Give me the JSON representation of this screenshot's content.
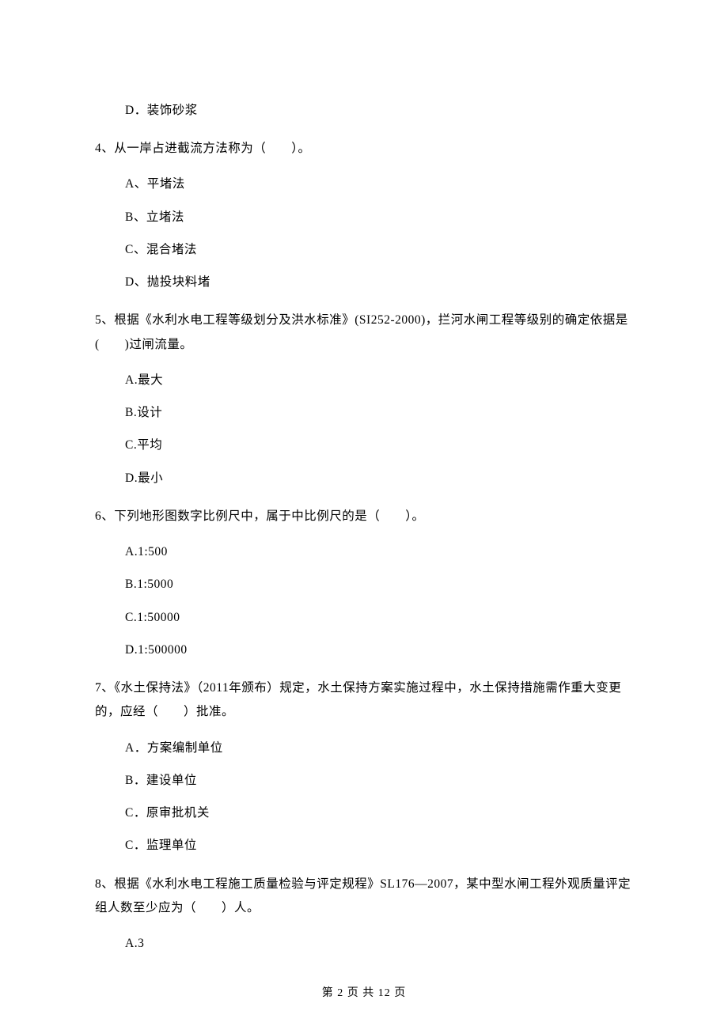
{
  "prev_question_trailing_option": {
    "label": "D．装饰砂浆"
  },
  "questions": [
    {
      "number": "4、",
      "stem": "从一岸占进截流方法称为（　　）。",
      "options": [
        "A、平堵法",
        "B、立堵法",
        "C、混合堵法",
        "D、抛投块料堵"
      ]
    },
    {
      "number": "5、",
      "stem": "根据《水利水电工程等级划分及洪水标准》(SI252-2000)，拦河水闸工程等级别的确定依据是(　　)过闸流量。",
      "options": [
        "A.最大",
        "B.设计",
        "C.平均",
        "D.最小"
      ]
    },
    {
      "number": "6、",
      "stem": "下列地形图数字比例尺中，属于中比例尺的是（　　）。",
      "options": [
        "A.1:500",
        "B.1:5000",
        "C.1:50000",
        "D.1:500000"
      ]
    },
    {
      "number": "7、",
      "stem": "《水土保持法》（2011年颁布）规定，水土保持方案实施过程中，水土保持措施需作重大变更的，应经（　　）批准。",
      "options": [
        "A．方案编制单位",
        "B．建设单位",
        "C．原审批机关",
        "C．监理单位"
      ]
    },
    {
      "number": "8、",
      "stem": "根据《水利水电工程施工质量检验与评定规程》SL176—2007，某中型水闸工程外观质量评定组人数至少应为（　　）人。",
      "options": [
        "A.3"
      ]
    }
  ],
  "footer": "第 2 页 共 12 页"
}
